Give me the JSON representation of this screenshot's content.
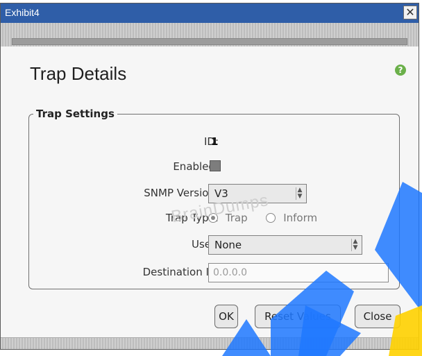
{
  "window": {
    "title": "Exhibit4",
    "close_glyph": "✕"
  },
  "header": {
    "title": "Trap Details",
    "help_icon": "help-icon",
    "help_glyph": "?"
  },
  "fieldset": {
    "legend": "Trap Settings",
    "id": {
      "label": "ID:",
      "value": "1"
    },
    "enabled": {
      "label": "Enabled:"
    },
    "snmp": {
      "label": "SNMP Version:",
      "value": "V3"
    },
    "trap_type": {
      "label": "Trap Type:",
      "options": [
        "Trap",
        "Inform"
      ],
      "selected": "Trap"
    },
    "user": {
      "label": "User:",
      "value": "None"
    },
    "dest_ip": {
      "label": "Destination IP:",
      "value": "0.0.0.0"
    }
  },
  "buttons": {
    "ok": "OK",
    "reset": "Reset Values",
    "close": "Close"
  },
  "watermark": {
    "text": "BrainDumps"
  },
  "colors": {
    "titlebar": "#2f5ea8",
    "help": "#6bb04a",
    "brand_blue": "#1f78ff",
    "brand_yellow": "#ffd200"
  }
}
